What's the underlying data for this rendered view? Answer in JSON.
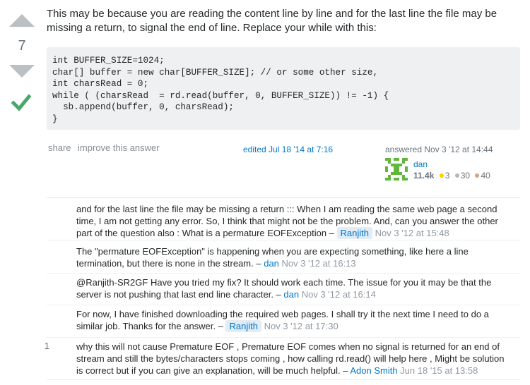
{
  "vote": {
    "count": "7",
    "upvote_icon": "arrow-up-icon",
    "downvote_icon": "arrow-down-icon",
    "accepted_icon": "checkmark-icon",
    "accepted_color": "#48a868"
  },
  "answer": {
    "text": "This may be because you are reading the content line by line and for the last line the file may be missing a return, to signal the end of line. Replace your while with this:",
    "code": "int BUFFER_SIZE=1024;\nchar[] buffer = new char[BUFFER_SIZE]; // or some other size,\nint charsRead = 0;\nwhile ( (charsRead  = rd.read(buffer, 0, BUFFER_SIZE)) != -1) {\n  sb.append(buffer, 0, charsRead);\n}"
  },
  "post_menu": {
    "share": "share",
    "improve": "improve this answer"
  },
  "edited": "edited Jul 18 '14 at 7:16",
  "answered": {
    "label": "answered Nov 3 '12 at 14:44",
    "user": "dan",
    "reputation": "11.4k",
    "gold": "3",
    "silver": "30",
    "bronze": "40"
  },
  "comments": [
    {
      "score": "",
      "text": "and for the last line the file may be missing a return ::: When I am reading the same web page a second time, I am not getting any error. So, I think that might not be the problem. And, can you answer the other part of the question also : What is a permature EOFException –",
      "user": "Ranjith",
      "date": "Nov 3 '12 at 15:48"
    },
    {
      "score": "",
      "text": "The \"permature EOFException\" is happening when you are expecting something, like here a line termination, but there is none in the stream. –",
      "user": "dan",
      "date": "Nov 3 '12 at 16:13"
    },
    {
      "score": "",
      "text": "@Ranjith-SR2GF Have you tried my fix? It should work each time. The issue for you it may be that the server is not pushing that last end line character. –",
      "user": "dan",
      "date": "Nov 3 '12 at 16:14"
    },
    {
      "score": "",
      "text": "For now, I have finished downloading the required web pages. I shall try it the next time I need to do a similar job. Thanks for the answer. –",
      "user": "Ranjith",
      "date": "Nov 3 '12 at 17:30"
    },
    {
      "score": "1",
      "text": "why this will not cause Premature EOF , Premature EOF comes when no signal is returned for an end of stream and still the bytes/characters stops coming , how calling rd.read() will help here , Might be solution is correct but if you can give an explanation, will be much helpful. –",
      "user": "Adon Smith",
      "date": "Jun 18 '15 at 13:58"
    }
  ]
}
